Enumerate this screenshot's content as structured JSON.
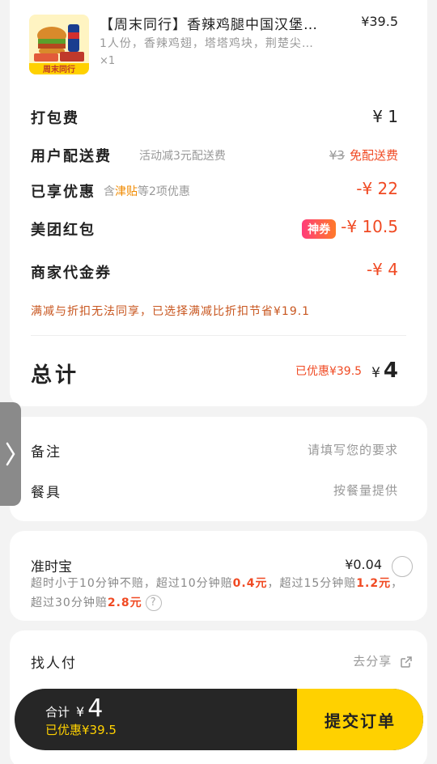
{
  "product": {
    "name": "【周末同行】香辣鸡腿中国汉堡…",
    "price": "¥39.5",
    "desc": "1人份，香辣鸡翅，塔塔鸡块，荆楚尖…",
    "qty": "×1",
    "badge_text": "周末同行"
  },
  "fees": {
    "packing_label": "打包费",
    "packing_value": "¥ 1",
    "delivery_label": "用户配送费",
    "delivery_note": "活动减3元配送费",
    "delivery_original": "¥3",
    "delivery_free": "免配送费",
    "discount_label": "已享优惠",
    "discount_note_pre": "含",
    "discount_note_hl": "津贴",
    "discount_note_post": "等2项优惠",
    "discount_value": "-¥ 22",
    "redpack_label": "美团红包",
    "redpack_badge": "神券",
    "redpack_value": "-¥ 10.5",
    "voucher_label": "商家代金券",
    "voucher_value": "-¥ 4",
    "notice": "满减与折扣无法同享，已选择满减比折扣节省¥19.1"
  },
  "total": {
    "label": "总计",
    "saved": "已优惠¥39.5",
    "currency": "¥",
    "amount": "4"
  },
  "notes": {
    "remark_label": "备注",
    "remark_placeholder": "请填写您的要求",
    "tableware_label": "餐具",
    "tableware_value": "按餐量提供"
  },
  "insurance": {
    "title": "准时宝",
    "price": "¥0.04",
    "desc_1": "超时小于10分钟不赔，超过10分钟赔",
    "amt_1": "0.4元",
    "desc_2": "，超过15分钟赔",
    "amt_2": "1.2元",
    "desc_3": "，超过30分钟赔",
    "amt_3": "2.8元",
    "help": "?"
  },
  "pay": {
    "label": "找人付",
    "share": "去分享"
  },
  "bar": {
    "total_label": "合计",
    "currency": "¥",
    "amount": "4",
    "saved": "已优惠¥39.5",
    "submit": "提交订单"
  },
  "colors": {
    "accent": "#ffd100",
    "discount": "#f04a23",
    "bar": "#262626"
  }
}
